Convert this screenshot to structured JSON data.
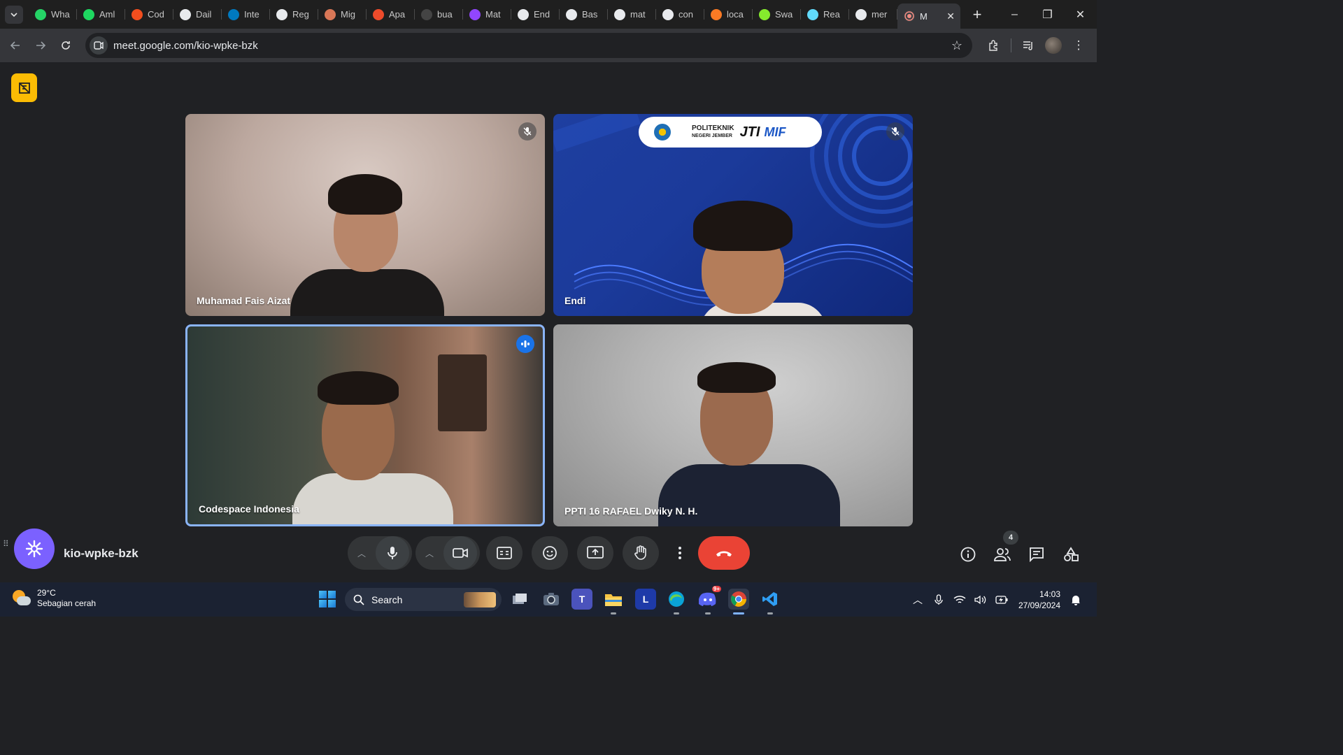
{
  "browser": {
    "tabs": [
      {
        "label": "Wha",
        "icon": "whatsapp-icon",
        "color": "#25d366"
      },
      {
        "label": "Aml",
        "icon": "spotify-icon",
        "color": "#1ed760"
      },
      {
        "label": "Cod",
        "icon": "figma-icon",
        "color": "#f24e1e"
      },
      {
        "label": "Dail",
        "icon": "notion-icon",
        "color": "#ffffff"
      },
      {
        "label": "Inte",
        "icon": "trello-icon",
        "color": "#0079bf"
      },
      {
        "label": "Reg",
        "icon": "openai-icon",
        "color": "#ffffff"
      },
      {
        "label": "Mig",
        "icon": "claude-icon",
        "color": "#d97757"
      },
      {
        "label": "Apa",
        "icon": "app-icon",
        "color": "#ee4b2b"
      },
      {
        "label": "bua",
        "icon": "dot-icon",
        "color": "#444444"
      },
      {
        "label": "Mat",
        "icon": "twitch-icon",
        "color": "#9146ff"
      },
      {
        "label": "End",
        "icon": "github-icon",
        "color": "#ffffff"
      },
      {
        "label": "Bas",
        "icon": "diamond-icon",
        "color": "#ffffff"
      },
      {
        "label": "mat",
        "icon": "google-icon",
        "color": "#ffffff"
      },
      {
        "label": "con",
        "icon": "google-icon",
        "color": "#ffffff"
      },
      {
        "label": "loca",
        "icon": "xampp-icon",
        "color": "#fb7a24"
      },
      {
        "label": "Swa",
        "icon": "swagger-icon",
        "color": "#85ea2d"
      },
      {
        "label": "Rea",
        "icon": "react-icon",
        "color": "#61dafb"
      },
      {
        "label": "mer",
        "icon": "google-icon",
        "color": "#ffffff"
      }
    ],
    "active_tab": {
      "label": "M",
      "icon": "recording-icon"
    },
    "url": "meet.google.com/kio-wpke-bzk"
  },
  "meet": {
    "participants": [
      {
        "name": "Muhamad Fais Aizat",
        "status": "muted"
      },
      {
        "name": "Endi",
        "status": "muted"
      },
      {
        "name": "Codespace Indonesia",
        "status": "speaking"
      },
      {
        "name": "PPTI 16 RAFAEL Dwiky N. H.",
        "status": "none"
      }
    ],
    "banner": {
      "line1": "POLITEKNIK",
      "line2": "NEGERI JEMBER",
      "brand1": "JTI",
      "brand2": "MIF"
    },
    "meeting_code": "kio-wpke-bzk",
    "people_count": "4",
    "colors": {
      "hangup": "#ea4335",
      "speaking": "#1a73e8",
      "highlight": "#8ab4f8"
    }
  },
  "taskbar": {
    "temperature": "29°C",
    "weather": "Sebagian cerah",
    "search_label": "Search",
    "time": "14:03",
    "date": "27/09/2024",
    "discord_badge": "9+"
  }
}
